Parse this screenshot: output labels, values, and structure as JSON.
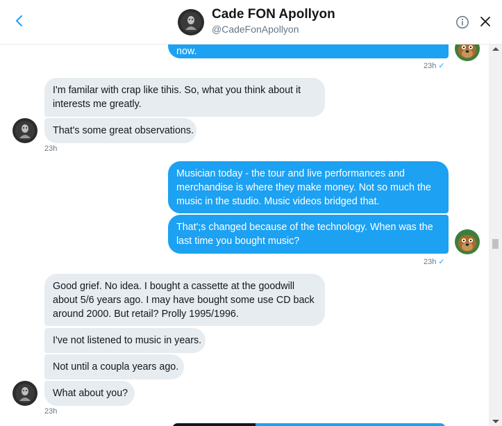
{
  "header": {
    "name": "Cade FON Apollyon",
    "handle": "@CadeFonApollyon",
    "back_icon": "chevron-left-icon",
    "info_icon": "info-icon",
    "close_icon": "close-icon"
  },
  "messages": [
    {
      "dir": "out",
      "text": "now."
    },
    {
      "dir": "out",
      "meta": "23h",
      "check": "✓"
    },
    {
      "dir": "in",
      "lines": [
        "I'm familar with crap like tihis. So, what you think about it",
        "interests me greatly."
      ]
    },
    {
      "dir": "in",
      "text": "That's some great observations."
    },
    {
      "dir": "in",
      "meta": "23h"
    },
    {
      "dir": "out",
      "lines": [
        "Musician today - the tour and live performances and",
        "merchandise is where they make money. Not so much the",
        "music in the studio. Music videos bridged that."
      ]
    },
    {
      "dir": "out",
      "lines": [
        "That';s changed because of the technology. When was the",
        "last time you bought music?"
      ]
    },
    {
      "dir": "out",
      "meta": "23h",
      "check": "✓"
    },
    {
      "dir": "in",
      "lines": [
        "Good grief. No idea. I bought a cassette at the goodwill",
        "about 5/6 years ago. I may have bought some use CD back",
        "around 2000. But retail? Prolly 1995/1996."
      ]
    },
    {
      "dir": "in",
      "text": "I've not listened to music in years."
    },
    {
      "dir": "in",
      "text": "Not until a coupla years ago."
    },
    {
      "dir": "in",
      "text": "What about you?"
    },
    {
      "dir": "in",
      "meta": "23h"
    }
  ],
  "colors": {
    "outgoing_bubble": "#1da1f2",
    "incoming_bubble": "#e6ecf0",
    "timestamp": "#657786"
  }
}
